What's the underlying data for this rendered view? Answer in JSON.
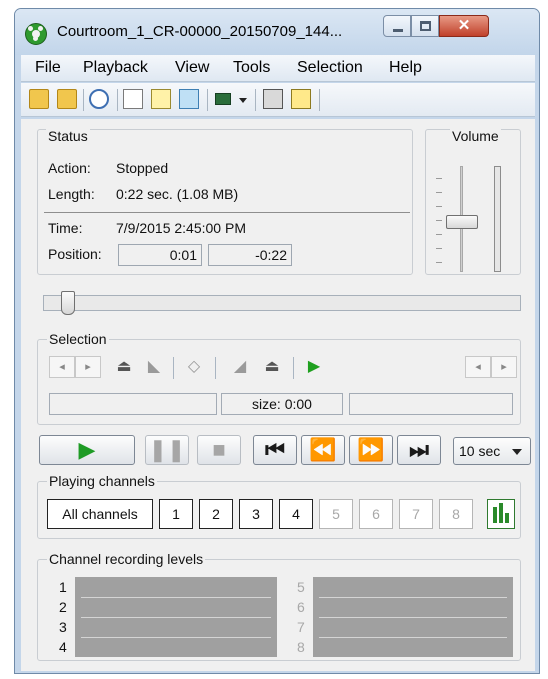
{
  "window": {
    "title": "Courtroom_1_CR-00000_20150709_144..."
  },
  "menu": [
    "File",
    "Playback",
    "View",
    "Tools",
    "Selection",
    "Help"
  ],
  "toolbar_icons": [
    "open-folder-icon",
    "folder-arrow-icon",
    "clock-icon",
    "properties-icon",
    "notes-icon",
    "copy-icon",
    "camera-icon",
    "monitor-icon",
    "zoom-icon"
  ],
  "status": {
    "title": "Status",
    "action_label": "Action:",
    "action_value": "Stopped",
    "length_label": "Length:",
    "length_value": "0:22 sec. (1.08 MB)",
    "time_label": "Time:",
    "time_value": "7/9/2015 2:45:00 PM",
    "position_label": "Position:",
    "position_elapsed": "0:01",
    "position_remaining": "-0:22"
  },
  "volume": {
    "title": "Volume",
    "level": 0.55
  },
  "position_slider": {
    "value": 0.02
  },
  "selection": {
    "title": "Selection",
    "size_text": "size: 0:00"
  },
  "playback": {
    "skip_options_selected": "10 sec"
  },
  "playing_channels": {
    "title": "Playing channels",
    "all_label": "All channels",
    "channels": [
      "1",
      "2",
      "3",
      "4",
      "5",
      "6",
      "7",
      "8"
    ]
  },
  "recording_levels": {
    "title": "Channel recording levels",
    "left_numbers": [
      "1",
      "2",
      "3",
      "4"
    ],
    "right_numbers": [
      "5",
      "6",
      "7",
      "8"
    ]
  }
}
